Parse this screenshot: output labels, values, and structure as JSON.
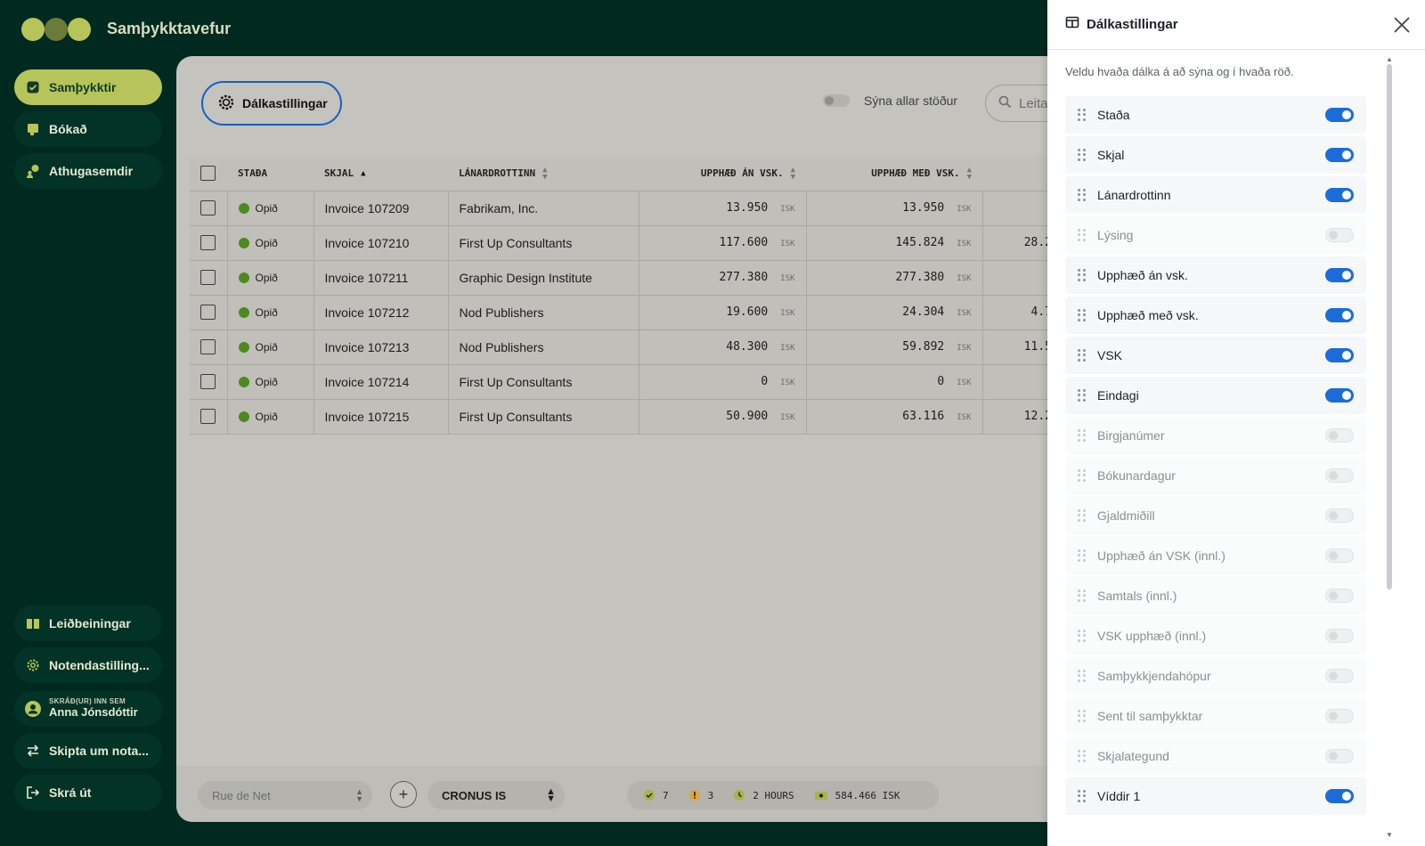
{
  "app": {
    "title": "Samþykktavefur"
  },
  "sidebar": {
    "items": [
      {
        "label": "Samþykktir",
        "active": true
      },
      {
        "label": "Bókað"
      },
      {
        "label": "Athugasemdir"
      }
    ],
    "bottom": {
      "guide": "Leiðbeiningar",
      "settings": "Notendastilling...",
      "signed_in_label": "SKRÁÐ(UR) INN SEM",
      "user_name": "Anna Jónsdóttir",
      "switch_user": "Skipta um nota...",
      "logout": "Skrá út"
    }
  },
  "toolbar": {
    "columns_button": "Dálkastillingar",
    "show_all_label": "Sýna allar stöður",
    "search_placeholder": "Leita"
  },
  "table": {
    "headers": [
      "STAÐA",
      "SKJAL",
      "LÁNARDROTTINN",
      "UPPHÆÐ ÁN VSK.",
      "UPPHÆÐ MEÐ VSK."
    ],
    "rows": [
      {
        "status": "Opið",
        "doc": "Invoice 107209",
        "vendor": "Fabrikam, Inc.",
        "net": "13.950",
        "gross": "13.950",
        "vat": "",
        "cur": "ISK"
      },
      {
        "status": "Opið",
        "doc": "Invoice 107210",
        "vendor": "First Up Consultants",
        "net": "117.600",
        "gross": "145.824",
        "vat": "28.2",
        "cur": "ISK"
      },
      {
        "status": "Opið",
        "doc": "Invoice 107211",
        "vendor": "Graphic Design Institute",
        "net": "277.380",
        "gross": "277.380",
        "vat": "",
        "cur": "ISK"
      },
      {
        "status": "Opið",
        "doc": "Invoice 107212",
        "vendor": "Nod Publishers",
        "net": "19.600",
        "gross": "24.304",
        "vat": "4.7",
        "cur": "ISK"
      },
      {
        "status": "Opið",
        "doc": "Invoice 107213",
        "vendor": "Nod Publishers",
        "net": "48.300",
        "gross": "59.892",
        "vat": "11.5",
        "cur": "ISK"
      },
      {
        "status": "Opið",
        "doc": "Invoice 107214",
        "vendor": "First Up Consultants",
        "net": "0",
        "gross": "0",
        "vat": "",
        "cur": "ISK"
      },
      {
        "status": "Opið",
        "doc": "Invoice 107215",
        "vendor": "First Up Consultants",
        "net": "50.900",
        "gross": "63.116",
        "vat": "12.2",
        "cur": "ISK"
      }
    ]
  },
  "bottom_bar": {
    "location_value": "Rue de Net",
    "company_value": "CRONUS IS",
    "stats": {
      "approved": "7",
      "warnings": "3",
      "time": "2 HOURS",
      "total": "584.466 ISK"
    }
  },
  "panel": {
    "title": "Dálkastillingar",
    "description": "Veldu hvaða dálka á að sýna og í hvaða röð.",
    "columns": [
      {
        "label": "Staða",
        "on": true
      },
      {
        "label": "Skjal",
        "on": true
      },
      {
        "label": "Lánardrottinn",
        "on": true
      },
      {
        "label": "Lýsing",
        "on": false
      },
      {
        "label": "Upphæð án vsk.",
        "on": true
      },
      {
        "label": "Upphæð með vsk.",
        "on": true
      },
      {
        "label": "VSK",
        "on": true
      },
      {
        "label": "Eindagi",
        "on": true
      },
      {
        "label": "Birgjanúmer",
        "on": false
      },
      {
        "label": "Bókunardagur",
        "on": false
      },
      {
        "label": "Gjaldmiðill",
        "on": false
      },
      {
        "label": "Upphæð án VSK (innl.)",
        "on": false
      },
      {
        "label": "Samtals (innl.)",
        "on": false
      },
      {
        "label": "VSK upphæð (innl.)",
        "on": false
      },
      {
        "label": "Samþykkjendahópur",
        "on": false
      },
      {
        "label": "Sent til samþykktar",
        "on": false
      },
      {
        "label": "Skjalategund",
        "on": false
      },
      {
        "label": "Víddir 1",
        "on": true
      }
    ]
  },
  "colors": {
    "sidebar_bg": "#002a20",
    "accent": "#b6c45a",
    "toggle_on": "#1b6cd8",
    "status_open": "#4d8a1e"
  }
}
